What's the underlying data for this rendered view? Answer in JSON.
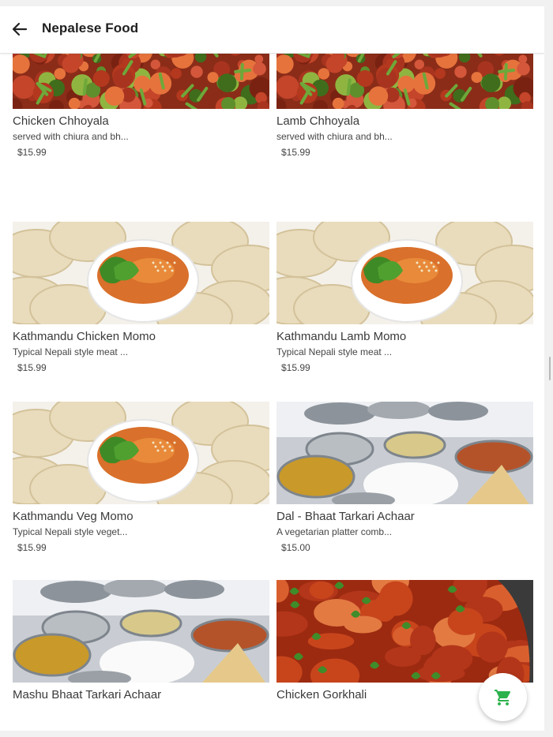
{
  "header": {
    "title": "Nepalese Food",
    "back_icon": "arrow-left-icon"
  },
  "items": [
    {
      "name": "Chicken Chhoyala",
      "description": "served with chiura and bh...",
      "price": "$15.99",
      "image": "chhoyala"
    },
    {
      "name": "Lamb Chhoyala",
      "description": "served with chiura and bh...",
      "price": "$15.99",
      "image": "chhoyala"
    },
    {
      "name": "Kathmandu Chicken Momo",
      "description": "Typical Nepali style meat ...",
      "price": "$15.99",
      "image": "momo"
    },
    {
      "name": "Kathmandu Lamb Momo",
      "description": "Typical Nepali style meat ...",
      "price": "$15.99",
      "image": "momo"
    },
    {
      "name": "Kathmandu Veg Momo",
      "description": "Typical Nepali style veget...",
      "price": "$15.99",
      "image": "momo"
    },
    {
      "name": "Dal - Bhaat Tarkari Achaar",
      "description": "A vegetarian platter comb...",
      "price": "$15.00",
      "image": "thali"
    },
    {
      "name": "Mashu Bhaat Tarkari Achaar",
      "image": "thali"
    },
    {
      "name": "Chicken Gorkhali",
      "image": "curry"
    }
  ],
  "cart": {
    "icon": "shopping-cart-icon",
    "color": "#2bb24c"
  }
}
